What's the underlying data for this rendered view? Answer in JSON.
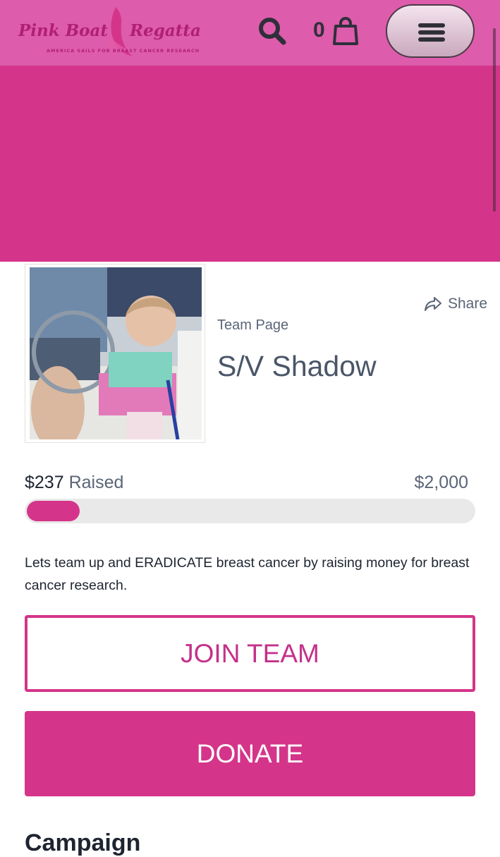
{
  "brand": {
    "logo_left": "Pink Boat",
    "logo_right": "Regatta",
    "tagline": "AMERICA SAILS FOR BREAST CANCER RESEARCH",
    "primary_color": "#d4358a",
    "header_color": "#dd5cab"
  },
  "header": {
    "search_icon": "search-icon",
    "cart_count": "0",
    "cart_icon": "shopping-bag-icon",
    "menu_icon": "hamburger-icon"
  },
  "profile": {
    "photo_alt": "child steering sailboat wheel",
    "share_label": "Share",
    "page_type": "Team Page",
    "team_name": "S/V Shadow"
  },
  "fundraising": {
    "raised_amount": "$237",
    "raised_label": "Raised",
    "goal": "$2,000",
    "progress_fraction": 0.1185
  },
  "description": "Lets team up and ERADICATE breast cancer by raising money for breast cancer research.",
  "actions": {
    "join_label": "JOIN TEAM",
    "donate_label": "DONATE"
  },
  "section": {
    "heading": "Campaign"
  }
}
